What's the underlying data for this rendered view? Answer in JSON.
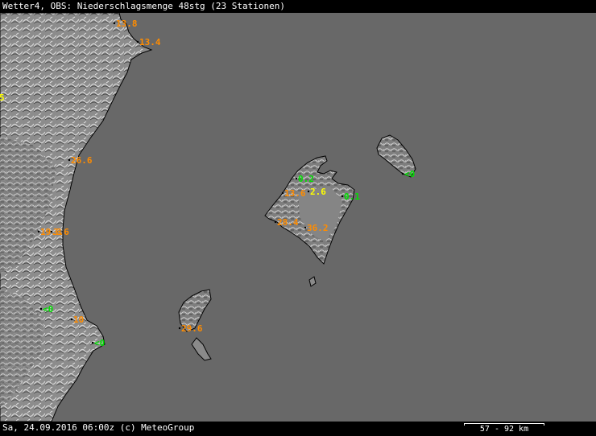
{
  "header": {
    "title": "Wetter4, OBS: Niederschlagsmenge 48stg (23 Stationen)"
  },
  "footer": {
    "timestamp": "Sa, 24.09.2016 06:00z (c) MeteoGroup",
    "scale_label": "57 - 92 km"
  },
  "colors": {
    "sea": "#686868",
    "land": "#8a8a8a",
    "coast": "#000000",
    "high": "#ff8c00",
    "mid": "#ffff00",
    "low": "#00e000"
  },
  "stations": [
    {
      "value": "13.8",
      "level": "high"
    },
    {
      "value": "13.4",
      "level": "high"
    },
    {
      "value": "5",
      "level": "mid"
    },
    {
      "value": "26.6",
      "level": "high"
    },
    {
      "value": "19.3",
      "level": "high"
    },
    {
      "value": "3.6",
      "level": "high"
    },
    {
      "value": "<0",
      "level": "low"
    },
    {
      "value": "10",
      "level": "high"
    },
    {
      "value": "<0",
      "level": "low"
    },
    {
      "value": "29.6",
      "level": "high"
    },
    {
      "value": "0.2",
      "level": "low"
    },
    {
      "value": "13.6",
      "level": "high"
    },
    {
      "value": "2.6",
      "level": "mid"
    },
    {
      "value": "0.1",
      "level": "low"
    },
    {
      "value": "28.4",
      "level": "high"
    },
    {
      "value": "36.2",
      "level": "high"
    },
    {
      "value": "<0",
      "level": "low"
    }
  ]
}
